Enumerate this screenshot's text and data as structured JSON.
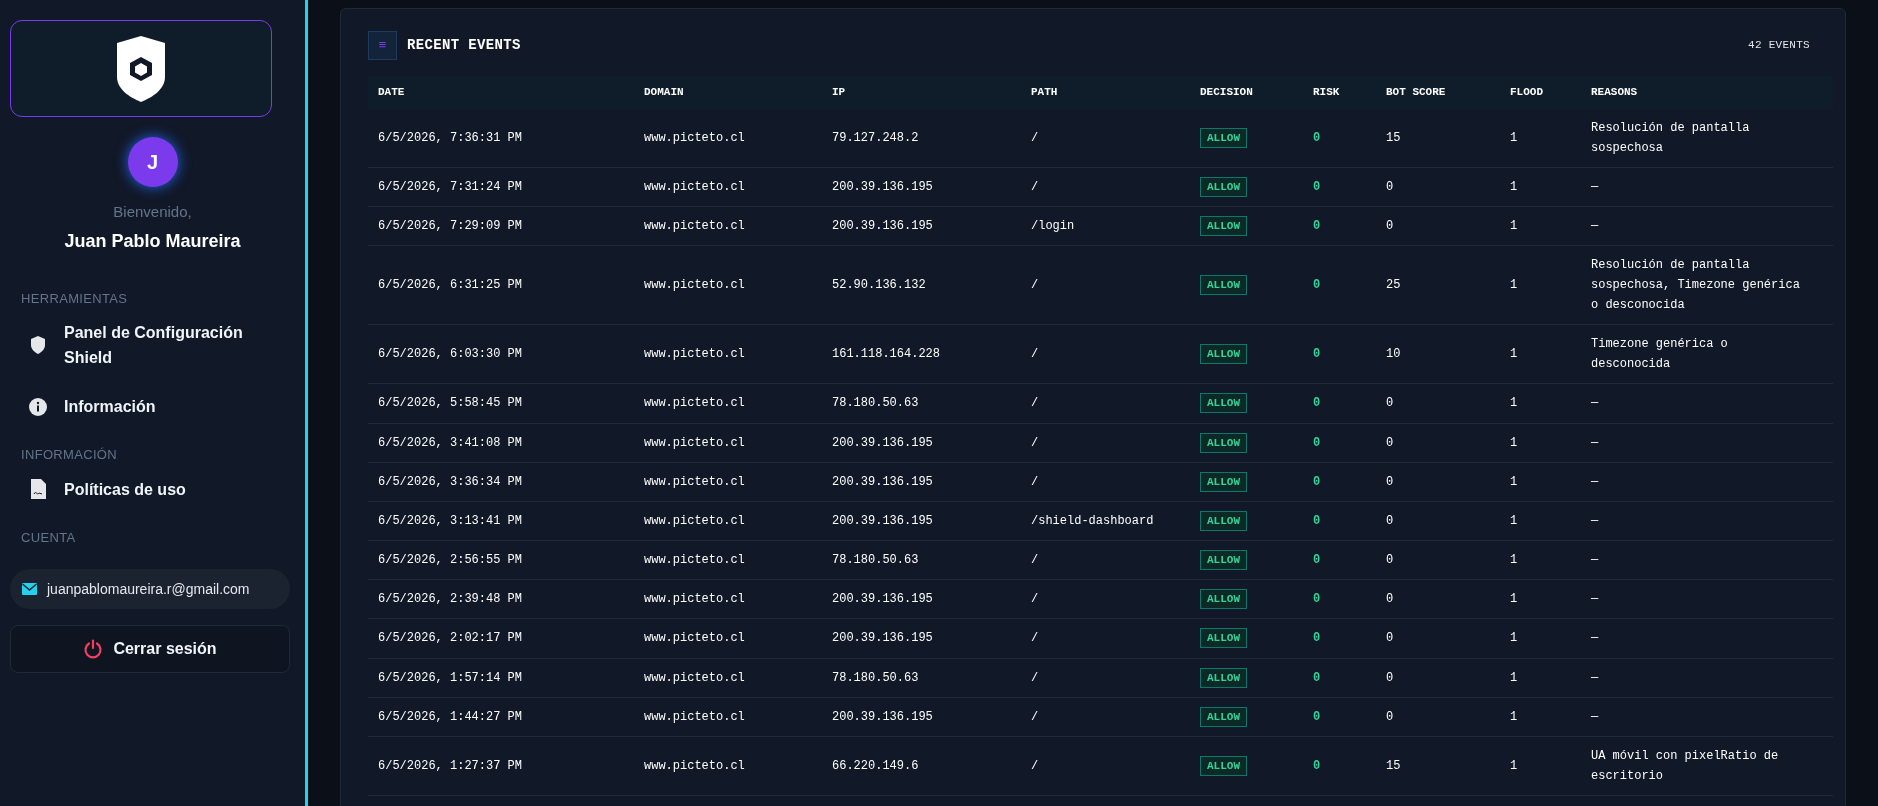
{
  "sidebar": {
    "welcome": "Bienvenido,",
    "avatar_letter": "J",
    "user_name": "Juan Pablo Maureira",
    "sections": [
      {
        "title": "HERRAMIENTAS",
        "items": [
          {
            "label": "Panel de Configuración Shield"
          },
          {
            "label": "Información"
          }
        ]
      },
      {
        "title": "INFORMACIÓN",
        "items": [
          {
            "label": "Políticas de uso"
          }
        ]
      },
      {
        "title": "CUENTA"
      }
    ],
    "email": "juanpablomaureira.r@gmail.com",
    "logout": "Cerrar sesión"
  },
  "events": {
    "menu_icon": "≡",
    "title": "RECENT EVENTS",
    "count": "42 EVENTS",
    "columns": [
      "DATE",
      "DOMAIN",
      "IP",
      "PATH",
      "DECISION",
      "RISK",
      "BOT SCORE",
      "FLOOD",
      "REASONS"
    ],
    "rows": [
      {
        "date": "6/5/2026, 7:36:31 PM",
        "domain": "www.picteto.cl",
        "ip": "79.127.248.2",
        "path": "/",
        "decision": "ALLOW",
        "risk": "0",
        "bot_score": "15",
        "flood": "1",
        "reasons": "Resolución de pantalla sospechosa"
      },
      {
        "date": "6/5/2026, 7:31:24 PM",
        "domain": "www.picteto.cl",
        "ip": "200.39.136.195",
        "path": "/",
        "decision": "ALLOW",
        "risk": "0",
        "bot_score": "0",
        "flood": "1",
        "reasons": "—"
      },
      {
        "date": "6/5/2026, 7:29:09 PM",
        "domain": "www.picteto.cl",
        "ip": "200.39.136.195",
        "path": "/login",
        "decision": "ALLOW",
        "risk": "0",
        "bot_score": "0",
        "flood": "1",
        "reasons": "—"
      },
      {
        "date": "6/5/2026, 6:31:25 PM",
        "domain": "www.picteto.cl",
        "ip": "52.90.136.132",
        "path": "/",
        "decision": "ALLOW",
        "risk": "0",
        "bot_score": "25",
        "flood": "1",
        "reasons": "Resolución de pantalla sospechosa, Timezone genérica o desconocida"
      },
      {
        "date": "6/5/2026, 6:03:30 PM",
        "domain": "www.picteto.cl",
        "ip": "161.118.164.228",
        "path": "/",
        "decision": "ALLOW",
        "risk": "0",
        "bot_score": "10",
        "flood": "1",
        "reasons": "Timezone genérica o desconocida"
      },
      {
        "date": "6/5/2026, 5:58:45 PM",
        "domain": "www.picteto.cl",
        "ip": "78.180.50.63",
        "path": "/",
        "decision": "ALLOW",
        "risk": "0",
        "bot_score": "0",
        "flood": "1",
        "reasons": "—"
      },
      {
        "date": "6/5/2026, 3:41:08 PM",
        "domain": "www.picteto.cl",
        "ip": "200.39.136.195",
        "path": "/",
        "decision": "ALLOW",
        "risk": "0",
        "bot_score": "0",
        "flood": "1",
        "reasons": "—"
      },
      {
        "date": "6/5/2026, 3:36:34 PM",
        "domain": "www.picteto.cl",
        "ip": "200.39.136.195",
        "path": "/",
        "decision": "ALLOW",
        "risk": "0",
        "bot_score": "0",
        "flood": "1",
        "reasons": "—"
      },
      {
        "date": "6/5/2026, 3:13:41 PM",
        "domain": "www.picteto.cl",
        "ip": "200.39.136.195",
        "path": "/shield-dashboard",
        "decision": "ALLOW",
        "risk": "0",
        "bot_score": "0",
        "flood": "1",
        "reasons": "—"
      },
      {
        "date": "6/5/2026, 2:56:55 PM",
        "domain": "www.picteto.cl",
        "ip": "78.180.50.63",
        "path": "/",
        "decision": "ALLOW",
        "risk": "0",
        "bot_score": "0",
        "flood": "1",
        "reasons": "—"
      },
      {
        "date": "6/5/2026, 2:39:48 PM",
        "domain": "www.picteto.cl",
        "ip": "200.39.136.195",
        "path": "/",
        "decision": "ALLOW",
        "risk": "0",
        "bot_score": "0",
        "flood": "1",
        "reasons": "—"
      },
      {
        "date": "6/5/2026, 2:02:17 PM",
        "domain": "www.picteto.cl",
        "ip": "200.39.136.195",
        "path": "/",
        "decision": "ALLOW",
        "risk": "0",
        "bot_score": "0",
        "flood": "1",
        "reasons": "—"
      },
      {
        "date": "6/5/2026, 1:57:14 PM",
        "domain": "www.picteto.cl",
        "ip": "78.180.50.63",
        "path": "/",
        "decision": "ALLOW",
        "risk": "0",
        "bot_score": "0",
        "flood": "1",
        "reasons": "—"
      },
      {
        "date": "6/5/2026, 1:44:27 PM",
        "domain": "www.picteto.cl",
        "ip": "200.39.136.195",
        "path": "/",
        "decision": "ALLOW",
        "risk": "0",
        "bot_score": "0",
        "flood": "1",
        "reasons": "—"
      },
      {
        "date": "6/5/2026, 1:27:37 PM",
        "domain": "www.picteto.cl",
        "ip": "66.220.149.6",
        "path": "/",
        "decision": "ALLOW",
        "risk": "0",
        "bot_score": "15",
        "flood": "1",
        "reasons": "UA móvil con pixelRatio de escritorio"
      }
    ]
  }
}
